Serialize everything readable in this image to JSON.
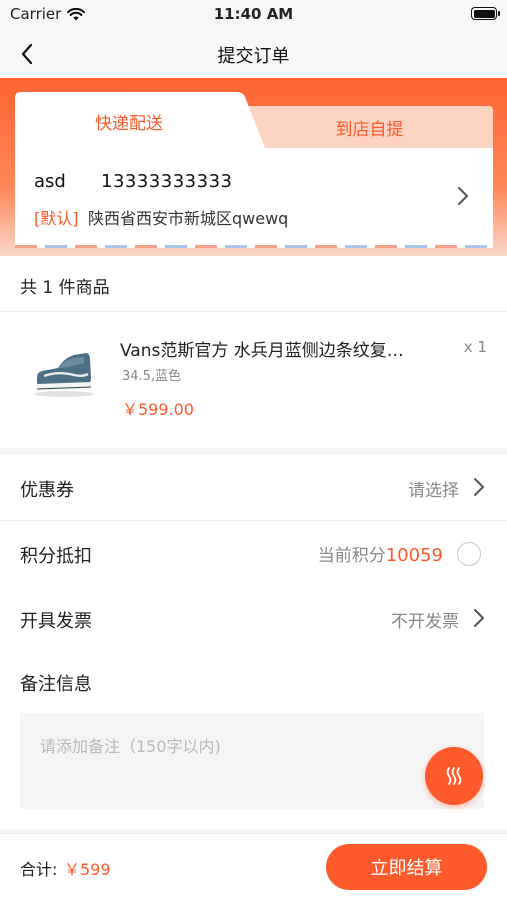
{
  "status_bar": {
    "carrier": "Carrier",
    "time": "11:40 AM"
  },
  "nav": {
    "title": "提交订单"
  },
  "delivery_tabs": {
    "express": "快递配送",
    "pickup": "到店自提"
  },
  "address": {
    "name": "asd",
    "phone": "13333333333",
    "default_tag": "[默认]",
    "detail": "陕西省西安市新城区qwewq"
  },
  "goods": {
    "count_label": "共 1 件商品",
    "items": [
      {
        "name": "Vans范斯官方 水兵月蓝侧边条纹复…",
        "spec": "34.5,蓝色",
        "price": "￥599.00",
        "qty": "x 1"
      }
    ]
  },
  "coupon": {
    "label": "优惠券",
    "value": "请选择"
  },
  "points": {
    "label": "积分抵扣",
    "prefix": "当前积分",
    "value": "10059"
  },
  "invoice": {
    "label": "开具发票",
    "value": "不开发票"
  },
  "remark": {
    "label": "备注信息",
    "placeholder": "请添加备注（150字以内)"
  },
  "footer": {
    "total_label": "合计:",
    "total_value": "￥599",
    "checkout": "立即结算"
  },
  "colors": {
    "accent": "#ff5a2c",
    "tab_inactive": "#fdd4c2",
    "page_bg": "#f5f5f5"
  }
}
